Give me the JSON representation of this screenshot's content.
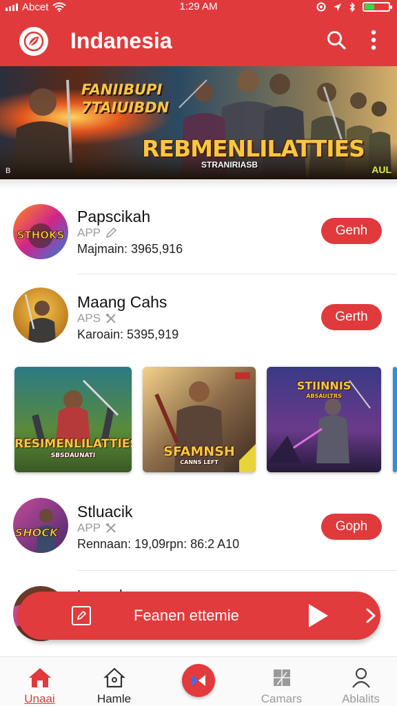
{
  "status_bar": {
    "carrier": "Abcet",
    "time": "1:29 AM",
    "battery_level": 0.4
  },
  "app_bar": {
    "title": "Indanesia",
    "logo_icon": "leaf-badge-icon",
    "search_icon": "search-icon",
    "more_icon": "more-vertical-icon"
  },
  "banner": {
    "title_line1": "FANIIBUPI",
    "title_line2": "7TAIUIBDN",
    "headline": "REBMENLILATTIES",
    "subtitle": "STRANIRIASB",
    "corner_tag": "AUL",
    "corner_tag_left": "B"
  },
  "apps": [
    {
      "title": "Papscikah",
      "type": "APP",
      "type_icon": "pencil-icon",
      "meta": "Majmain: 3965,916",
      "button": "Genh"
    },
    {
      "title": "Maang Cahs",
      "type": "APS",
      "type_icon": "tools-icon",
      "meta": "Karoain: 5395,919",
      "button": "Gerth"
    },
    {
      "title": "Stluacik",
      "type": "APP",
      "type_icon": "tools-icon",
      "meta": "Rennaan: 19,09rpn: 86:2 A10",
      "button": "Goph"
    },
    {
      "title": "Lmnenk"
    }
  ],
  "carousel": [
    {
      "caption": "RESIMENLILATTIES",
      "subcaption": "SBSDAUNATI"
    },
    {
      "caption": "SFAMNSH",
      "subcaption": "CANNS LEFT"
    },
    {
      "caption": "STIINNIS",
      "subcaption": "ABSAULTRS"
    }
  ],
  "icon_texts": {
    "app1": "STHOKS",
    "app3": "SHOCK"
  },
  "floating_banner": {
    "label": "Feanen ettemie",
    "icon": "edit-square-icon",
    "play_icon": "play-icon",
    "next_icon": "chevron-right-icon"
  },
  "bottom_nav": [
    {
      "label": "Unaai",
      "icon": "home-icon",
      "active": true
    },
    {
      "label": "Hamle",
      "icon": "house-outline-icon",
      "active": false
    },
    {
      "label": "",
      "icon": "center-action-icon",
      "active": false
    },
    {
      "label": "Camars",
      "icon": "box-icon",
      "active": false
    },
    {
      "label": "Ablalits",
      "icon": "person-icon",
      "active": false
    }
  ],
  "colors": {
    "brand_red": "#e03a3c",
    "battery_green": "#39d353",
    "headline_gold": "#f7c744"
  }
}
